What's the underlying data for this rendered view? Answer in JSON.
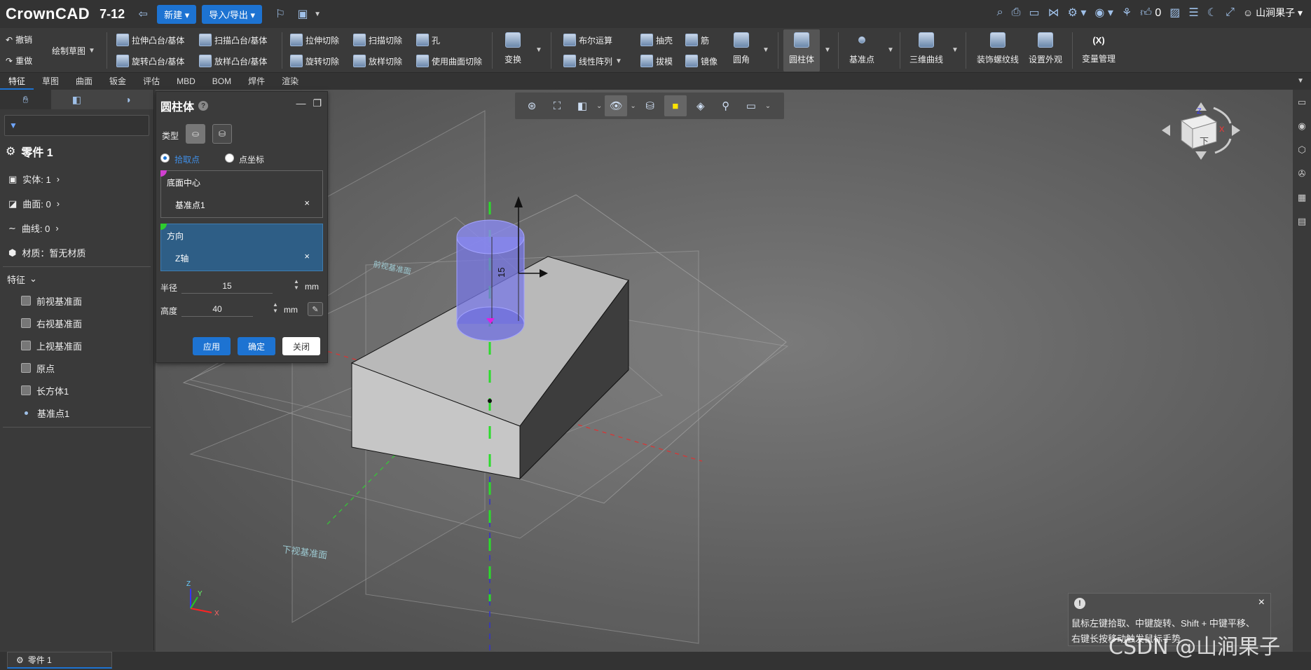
{
  "app": {
    "logo": "CrownCAD",
    "version": "7-12",
    "new_label": "新建",
    "import_export_label": "导入/导出",
    "likes": "0",
    "user_name": "山涧果子"
  },
  "ribbon": {
    "undo": "撤销",
    "redo": "重做",
    "sketch": "绘制草图",
    "extrude_boss": "拉伸凸台/基体",
    "sweep_boss": "扫描凸台/基体",
    "revolve_boss": "旋转凸台/基体",
    "loft_boss": "放样凸台/基体",
    "extrude_cut": "拉伸切除",
    "sweep_cut": "扫描切除",
    "hole": "孔",
    "revolve_cut": "旋转切除",
    "loft_cut": "放样切除",
    "surface_cut": "使用曲面切除",
    "transform": "变换",
    "boolean": "布尔运算",
    "shell": "抽壳",
    "rib": "筋",
    "linear_pattern": "线性阵列",
    "draft": "拔模",
    "mirror": "镜像",
    "fillet": "圆角",
    "cylinder": "圆柱体",
    "datum_point": "基准点",
    "curve3d": "三维曲线",
    "thread": "装饰螺纹线",
    "appearance": "设置外观",
    "variables_icon": "(X)",
    "variables": "变量管理"
  },
  "tabs": [
    "特征",
    "草图",
    "曲面",
    "钣金",
    "评估",
    "MBD",
    "BOM",
    "焊件",
    "渲染"
  ],
  "tree": {
    "part_name": "零件 1",
    "solid": "实体: 1",
    "surface": "曲面: 0",
    "curve": "曲线: 0",
    "material": "材质：暂无材质",
    "features_label": "特征",
    "items": [
      "前视基准面",
      "右视基准面",
      "上视基准面",
      "原点",
      "长方体1",
      "基准点1"
    ]
  },
  "dialog": {
    "title": "圆柱体",
    "help": "?",
    "type_label": "类型",
    "radio_pick": "拾取点",
    "radio_coord": "点坐标",
    "bottom_center_label": "底面中心",
    "bottom_center_value": "基准点1",
    "direction_label": "方向",
    "direction_value": "Z轴",
    "remove": "×",
    "radius_label": "半径",
    "radius_value": "15",
    "height_label": "高度",
    "height_value": "40",
    "unit": "mm",
    "apply": "应用",
    "ok": "确定",
    "close": "关闭"
  },
  "viewport": {
    "dim_label": "15",
    "plane_front": "前视基准面",
    "plane_bottom": "下视基准面",
    "cube_face": "下",
    "axis_x": "X",
    "axis_y": "Y",
    "axis_z": "Z"
  },
  "tip": {
    "icon": "!",
    "line1": "鼠标左键拾取、中键旋转、Shift + 中键平移、",
    "line2": "右键长按移动触发鼠标手势",
    "close": "×"
  },
  "status": {
    "tab_label": "零件 1"
  },
  "watermark": "CSDN @山涧果子"
}
